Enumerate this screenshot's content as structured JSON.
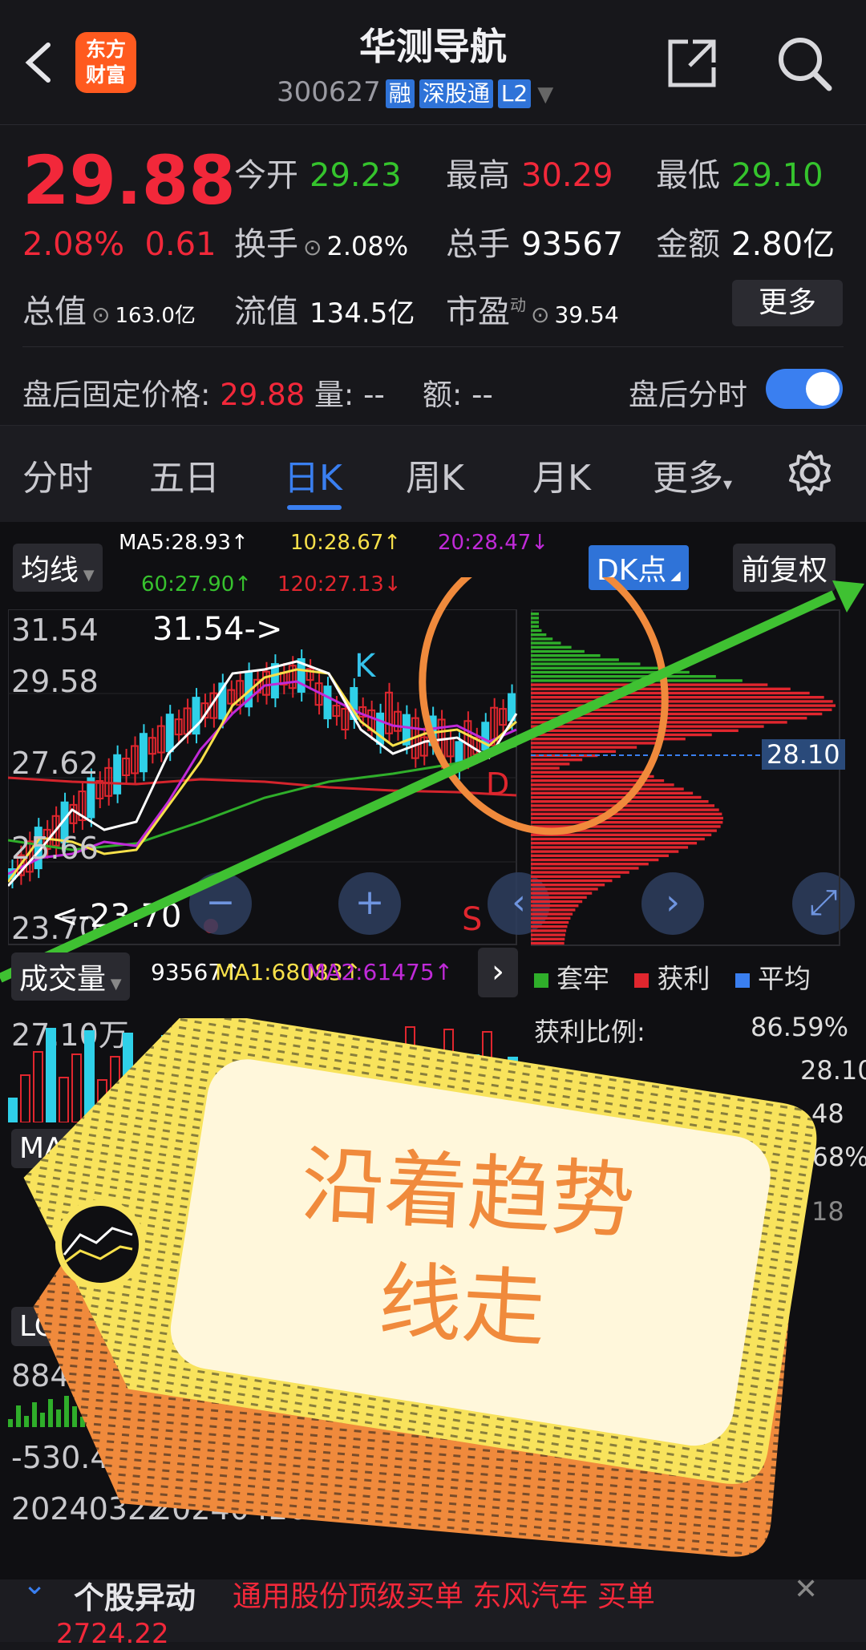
{
  "header": {
    "logo_line1": "东方",
    "logo_line2": "财富",
    "stock_name": "华测导航",
    "stock_code": "300627",
    "tag1": "融",
    "tag2": "深股通",
    "tag3": "L2"
  },
  "quote": {
    "price": "29.88",
    "change_pct": "2.08%",
    "change_amt": "0.61",
    "open_label": "今开",
    "open": "29.23",
    "high_label": "最高",
    "high": "30.29",
    "low_label": "最低",
    "low": "29.10",
    "turnover_label": "换手",
    "turnover": "2.08%",
    "volume_label": "总手",
    "volume": "93567",
    "amount_label": "金额",
    "amount": "2.80亿",
    "mcap_label": "总值",
    "mcap": "163.0亿",
    "float_label": "流值",
    "float": "134.5亿",
    "pe_label": "市盈",
    "pe_sup": "动",
    "pe": "39.54",
    "more_button": "更多"
  },
  "after_hours": {
    "price_label": "盘后固定价格:",
    "price": "29.88",
    "vol_label": "量:",
    "vol": "--",
    "amt_label": "额:",
    "amt": "--",
    "time_label": "盘后分时"
  },
  "tabs": [
    "分时",
    "五日",
    "日K",
    "周K",
    "月K",
    "更多"
  ],
  "chart_controls": {
    "ma_select": "均线",
    "dk_button": "DK点",
    "adjust_button": "前复权",
    "ma5": "MA5:28.93↑",
    "ma10": "10:28.67↑",
    "ma20": "20:28.47↓",
    "ma60": "60:27.90↑",
    "ma120": "120:27.13↓"
  },
  "price_axis": [
    "31.54",
    "29.58",
    "27.62",
    "25.66",
    "23.70"
  ],
  "chart_annotations": {
    "high_marker": "31.54->",
    "low_marker": "<-23.70",
    "k": "K",
    "d": "D",
    "s": "S",
    "chip_price": "28.10"
  },
  "volume": {
    "select": "成交量",
    "vol": "93567↑",
    "ma1": "MA1:68083↑",
    "ma2": "MA2:61475↑",
    "axis_max": "27.10万"
  },
  "chip_legend": {
    "trapped": "套牢",
    "profit": "获利",
    "average": "平均"
  },
  "chip_stats": {
    "profit_ratio_label": "获利比例:",
    "profit_ratio": "86.59%",
    "avg_cost": "28.10",
    "partial1": "48",
    "partial2": "0.68%",
    "partial3": "18"
  },
  "lower_indicators": {
    "macd_label": "MAC",
    "log_label": "LO",
    "val1": "884.3",
    "val2": "-530.42",
    "date1": "20240322",
    "date2": "20240426"
  },
  "overlay_tag": {
    "line1": "沿着趋势",
    "line2": "线走"
  },
  "footer": {
    "news_label": "个股异动",
    "news_text": "通用股份顶级买单 东风汽车 买单",
    "index_value": "2724.22"
  },
  "colors": {
    "up": "#f2283a",
    "down": "#35c42d",
    "accent": "#3a7ff0",
    "tag_orange": "#f08a3c"
  }
}
